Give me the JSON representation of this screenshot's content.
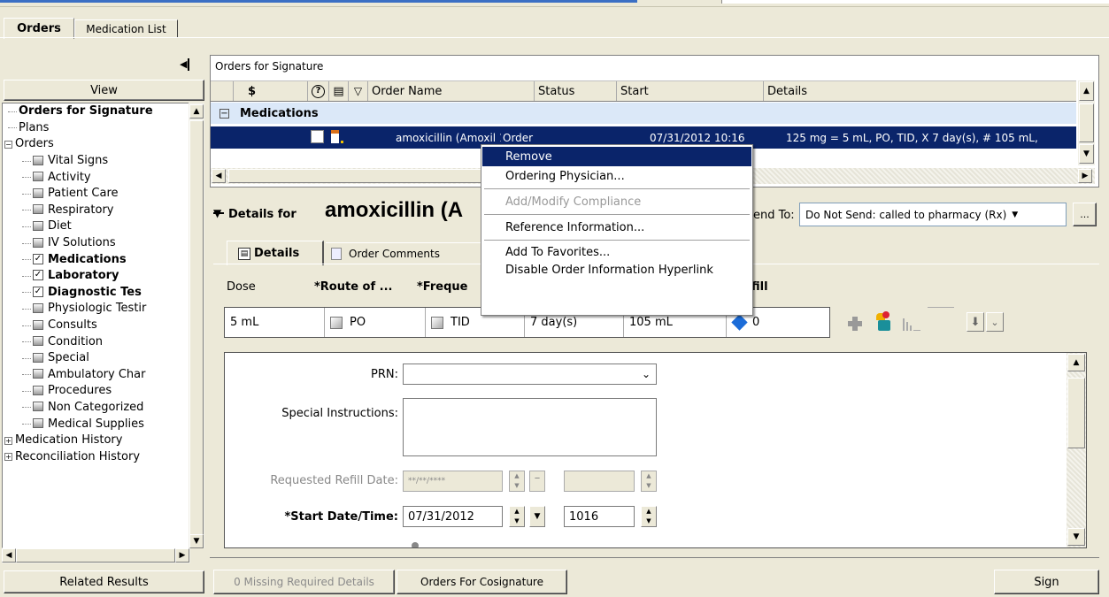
{
  "tabs": {
    "orders": "Orders",
    "medication_list": "Medication List"
  },
  "left_panel": {
    "view_label": "View",
    "tree": [
      {
        "label": "Orders for Signature",
        "bold": true,
        "type": "leaf0"
      },
      {
        "label": "Plans",
        "type": "leaf0"
      },
      {
        "label": "Orders",
        "type": "folder"
      },
      {
        "label": "Vital Signs",
        "type": "cb"
      },
      {
        "label": "Activity",
        "type": "cb"
      },
      {
        "label": "Patient Care",
        "type": "cb"
      },
      {
        "label": "Respiratory",
        "type": "cb"
      },
      {
        "label": "Diet",
        "type": "cb"
      },
      {
        "label": "IV Solutions",
        "type": "cb"
      },
      {
        "label": "Medications",
        "type": "chk",
        "bold": true
      },
      {
        "label": "Laboratory",
        "type": "chk",
        "bold": true
      },
      {
        "label": "Diagnostic Tes",
        "type": "chk",
        "bold": true
      },
      {
        "label": "Physiologic Testir",
        "type": "cb"
      },
      {
        "label": "Consults",
        "type": "cb"
      },
      {
        "label": "Condition",
        "type": "cb"
      },
      {
        "label": "Special",
        "type": "cb"
      },
      {
        "label": "Ambulatory Char",
        "type": "cb"
      },
      {
        "label": "Procedures",
        "type": "cb"
      },
      {
        "label": "Non Categorized",
        "type": "cb"
      },
      {
        "label": "Medical Supplies",
        "type": "cb"
      },
      {
        "label": "Medication History",
        "type": "plus"
      },
      {
        "label": "Reconciliation History",
        "type": "plus"
      }
    ],
    "related_results": "Related Results"
  },
  "orders_panel": {
    "title": "Orders for Signature",
    "columns": {
      "dollar": "$",
      "order_name": "Order Name",
      "status": "Status",
      "start": "Start",
      "details": "Details"
    },
    "group": "Medications",
    "row": {
      "order_name": "amoxicillin (Amoxil 125 m...",
      "status": "Order",
      "start": "07/31/2012 10:16",
      "details": "125 mg = 5 mL, PO, TID, X 7 day(s), # 105 mL,"
    }
  },
  "context_menu": {
    "items": [
      "Remove",
      "Ordering Physician...",
      "Add/Modify Compliance",
      "Reference Information...",
      "Add To Favorites...",
      "Disable Order Information Hyperlink"
    ]
  },
  "details": {
    "prefix": "Details for",
    "drug": "amoxicillin (A",
    "send_to_label": "end To:",
    "send_to_value": "Do Not Send: called to pharmacy (Rx)",
    "tab_details": "Details",
    "tab_comments": "Order Comments",
    "grid_headers": [
      "Dose",
      "*Route of ...",
      "*Freque",
      "",
      "",
      "fill"
    ],
    "grid_values": {
      "dose": "5 mL",
      "route": "PO",
      "frequency": "TID",
      "duration": "7 day(s)",
      "dispense": "105 mL",
      "refill": "0"
    },
    "form": {
      "prn_label": "PRN:",
      "prn_value": "",
      "special_label": "Special Instructions:",
      "refill_date_label": "Requested Refill Date:",
      "refill_date_placeholder": "**/**/****",
      "start_label": "*Start Date/Time:",
      "start_date": "07/31/2012",
      "start_time": "1016"
    }
  },
  "footer": {
    "missing": "0 Missing Required Details",
    "cosign": "Orders For Cosignature",
    "sign": "Sign"
  },
  "colors": {
    "selection": "#0a246a",
    "group_row": "#dbe8f8",
    "accent_blue": "#1c6cd8"
  }
}
